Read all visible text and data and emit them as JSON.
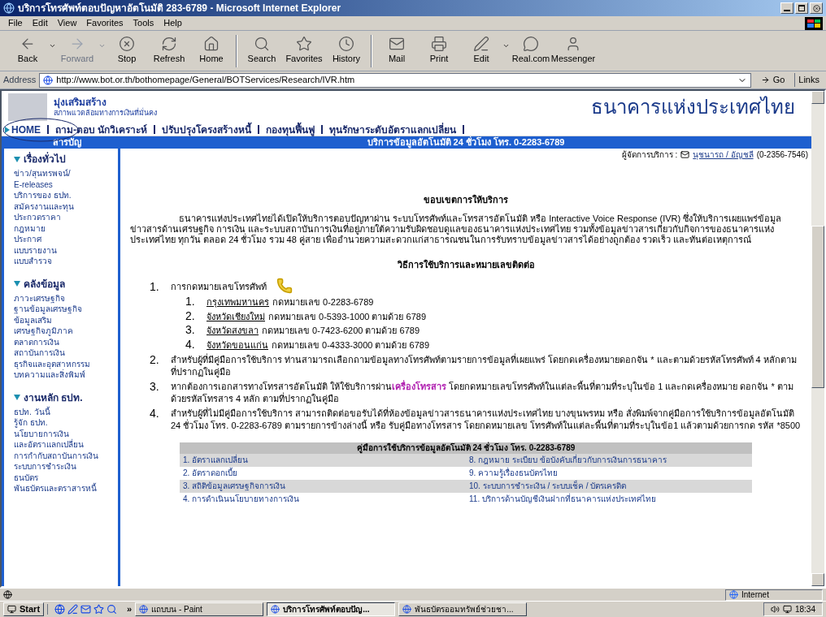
{
  "window": {
    "title": "บริการโทรศัพท์ตอบปัญหาอัตโนมัติ 283-6789 - Microsoft Internet Explorer"
  },
  "menu": [
    "File",
    "Edit",
    "View",
    "Favorites",
    "Tools",
    "Help"
  ],
  "toolbar": [
    {
      "label": "Back",
      "disabled": false,
      "dropdown": true
    },
    {
      "label": "Forward",
      "disabled": true,
      "dropdown": true
    },
    {
      "label": "Stop",
      "disabled": false,
      "dropdown": false
    },
    {
      "label": "Refresh",
      "disabled": false,
      "dropdown": false
    },
    {
      "label": "Home",
      "disabled": false,
      "dropdown": false
    },
    {
      "label": "Search",
      "disabled": false,
      "dropdown": false
    },
    {
      "label": "Favorites",
      "disabled": false,
      "dropdown": false
    },
    {
      "label": "History",
      "disabled": false,
      "dropdown": false
    },
    {
      "label": "Mail",
      "disabled": false,
      "dropdown": false
    },
    {
      "label": "Print",
      "disabled": false,
      "dropdown": false
    },
    {
      "label": "Edit",
      "disabled": false,
      "dropdown": true
    },
    {
      "label": "Real.com",
      "disabled": false,
      "dropdown": false
    },
    {
      "label": "Messenger",
      "disabled": false,
      "dropdown": false
    }
  ],
  "address": {
    "label": "Address",
    "value": "http://www.bot.or.th/bothomepage/General/BOTServices/Research/IVR.htm",
    "go": "Go",
    "links": "Links"
  },
  "banner": {
    "slogan": "มุ่งเสริมสร้าง",
    "subslogan": "สภาพแวดล้อมทางการเงินที่มั่นคง",
    "bank_name": "ธนาคารแห่งประเทศไทย"
  },
  "nav": [
    {
      "label": "HOME",
      "kind": "home"
    },
    {
      "label": "ถาม-ตอบ นักวิเคราะห์",
      "kind": "link"
    },
    {
      "label": "ปรับปรุงโครงสร้างหนี้",
      "kind": "link"
    },
    {
      "label": "กองทุนฟื้นฟู",
      "kind": "link"
    },
    {
      "label": "ทุนรักษาระดับอัตราแลกเปลี่ยน",
      "kind": "link"
    }
  ],
  "sidebar": {
    "title": "สารบัญ",
    "sections": [
      {
        "title": "เรื่องทั่วไป",
        "items": [
          "ข่าว/สุนทรพจน์/",
          "E-releases",
          "บริการของ ธปท.",
          "สมัครงานและทุน",
          "ประกวดราคา",
          "กฎหมาย",
          "ประกาศ",
          "แบบรายงาน",
          "แบบสำรวจ"
        ]
      },
      {
        "title": "คลังข้อมูล",
        "items": [
          "ภาวะเศรษฐกิจ",
          "ฐานข้อมูลเศรษฐกิจ",
          "ข้อมูลเสริม",
          "เศรษฐกิจภูมิภาค",
          "ตลาดการเงิน",
          "สถาบันการเงิน",
          "ธุรกิจและอุตสาหกรรม",
          "บทความและสิ่งพิมพ์"
        ]
      },
      {
        "title": "งานหลัก ธปท.",
        "items": [
          "ธปท. วันนี้",
          "รู้จัก ธปท.",
          "นโยบายการเงิน",
          "และอัตราแลกเปลี่ยน",
          "การกำกับสถาบันการเงิน",
          "ระบบการชำระเงิน",
          "ธนบัตร",
          "พันธบัตรและตราสารหนี้"
        ]
      }
    ]
  },
  "page_title": "บริการข้อมูลอัตโนมัติ 24 ชั่วโมง โทร. 0-2283-6789",
  "contact": {
    "label": "ผู้จัดการบริการ :",
    "names": "นุชนารถ / อัญชลี",
    "phone": "(0-2356-7546)"
  },
  "scope_heading": "ขอบเขตการให้บริการ",
  "intro": "ธนาคารแห่งประเทศไทยได้เปิดให้บริการตอบปัญหาผ่าน ระบบโทรศัพท์และโทรสารอัตโนมัติ หรือ Interactive Voice Response (IVR) ซึ่งให้บริการเผยแพร่ข้อมูลข่าวสารด้านเศรษฐกิจ การเงิน และระบบสถาบันการเงินที่อยู่ภายใต้ความรับผิดชอบดูแลของธนาคารแห่งประเทศไทย รวมทั้งข้อมูลข่าวสารเกี่ยวกับกิจการของธนาคารแห่งประเทศไทย ทุกวัน ตลอด 24 ชั่วโมง รวม 48 คู่สาย เพื่ออำนวยความสะดวกแก่สาธารณชนในการรับทราบข้อมูลข่าวสารได้อย่างถูกต้อง รวดเร็ว และทันต่อเหตุการณ์",
  "method_heading": "วิธีการใช้บริการและหมายเลขติดต่อ",
  "steps": [
    {
      "number": "1.",
      "text": "การกดหมายเลขโทรศัพท์",
      "phone_icon": true,
      "sub": [
        {
          "number": "1.",
          "link": "กรุงเทพมหานคร",
          "text": "กดหมายเลข 0-2283-6789"
        },
        {
          "number": "2.",
          "link": "จังหวัดเชียงใหม่",
          "text": "กดหมายเลข 0-5393-1000 ตามด้วย 6789"
        },
        {
          "number": "3.",
          "link": "จังหวัดสงขลา",
          "text": "กดหมายเลข 0-7423-6200 ตามด้วย 6789"
        },
        {
          "number": "4.",
          "link": "จังหวัดขอนแก่น",
          "text": "กดหมายเลข 0-4333-3000 ตามด้วย 6789"
        }
      ]
    },
    {
      "number": "2.",
      "text": "สำหรับผู้ที่มีคู่มือการใช้บริการ ท่านสามารถเลือกถามข้อมูลทางโทรศัพท์ตามรายการข้อมูลที่เผยแพร่ โดยกดเครื่องหมายดอกจัน * และตามด้วยรหัสโทรศัพท์ 4 หลักตามที่ปรากฏในคู่มือ",
      "phone_icon": false
    },
    {
      "number": "3.",
      "text": "หากต้องการเอกสารทางโทรสารอัตโนมัติ ให้ใช้บริการผ่าน",
      "link": "เครื่องโทรสาร",
      "text_after": " โดยกดหมายเลขโทรศัพท์ในแต่ละพื้นที่ตามที่ระบุในข้อ 1 และกดเครื่องหมาย ดอกจัน * ตามด้วยรหัสโทรสาร 4 หลัก ตามที่ปรากฏในคู่มือ",
      "phone_icon": false
    },
    {
      "number": "4.",
      "text": "สำหรับผู้ที่ไม่มีคู่มือการใช้บริการ สามารถติดต่อขอรับได้ที่ห้องข้อมูลข่าวสารธนาคารแห่งประเทศไทย บางขุนพรหม หรือ สั่งพิมพ์จากคู่มือการใช้บริการข้อมูลอัตโนมัติ 24 ชั่วโมง โทร. 0-2283-6789 ตามรายการข้างล่างนี้ หรือ รับคู่มือทางโทรสาร โดยกดหมายเลข โทรศัพท์ในแต่ละพื้นที่ตามที่ระบุในข้อ1 แล้วตามด้วยการกด รหัส *8500",
      "phone_icon": false
    }
  ],
  "guide_table": {
    "title": "คู่มือการใช้บริการข้อมูลอัตโนมัติ 24 ชั่วโมง โทร. 0-2283-6789",
    "rows": [
      [
        "1. อัตราแลกเปลี่ยน",
        "8. กฎหมาย ระเบียบ ข้อบังคับเกี่ยวกับการเงินการธนาคาร"
      ],
      [
        "2. อัตราดอกเบี้ย",
        "9. ความรู้เรื่องธนบัตรไทย"
      ],
      [
        "3. สถิติข้อมูลเศรษฐกิจการเงิน",
        "10. ระบบการชำระเงิน / ระบบเช็ค / บัตรเครดิต"
      ],
      [
        "4. การดำเนินนโยบายทางการเงิน",
        "11. บริการด้านบัญชีเงินฝากที่ธนาคารแห่งประเทศไทย"
      ]
    ]
  },
  "status_bar": {
    "zone": "Internet"
  },
  "taskbar": {
    "start": "Start",
    "more": "»",
    "tasks": [
      {
        "label": "แถบบน - Paint",
        "selected": false
      },
      {
        "label": "บริการโทรศัพท์ตอบปัญ...",
        "selected": true
      },
      {
        "label": "พันธบัตรออมทรัพย์ช่วยชา...",
        "selected": false
      }
    ],
    "time": "18:34"
  }
}
